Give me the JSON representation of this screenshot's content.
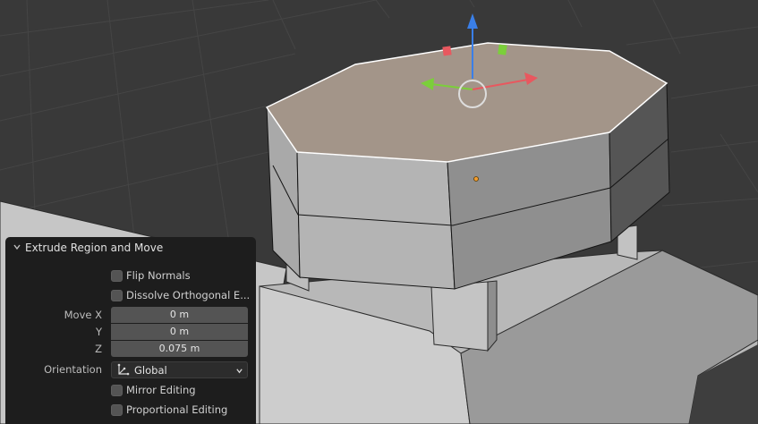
{
  "operator_panel": {
    "title": "Extrude Region and Move",
    "flip_normals": {
      "label": "Flip Normals",
      "checked": false
    },
    "dissolve_orthogonal": {
      "label": "Dissolve Orthogonal E...",
      "checked": false
    },
    "move": {
      "x_label": "Move X",
      "x_value": "0 m",
      "y_label": "Y",
      "y_value": "0 m",
      "z_label": "Z",
      "z_value": "0.075 m"
    },
    "orientation": {
      "label": "Orientation",
      "value": "Global",
      "icon": "global-orientation-icon"
    },
    "mirror_editing": {
      "label": "Mirror Editing",
      "checked": false
    },
    "proportional_editing": {
      "label": "Proportional Editing",
      "checked": false
    }
  },
  "gizmo": {
    "x_axis_color": "#e8585f",
    "y_axis_color": "#7bcf3a",
    "z_axis_color": "#3a7fe8"
  },
  "colors": {
    "viewport_bg": "#393939",
    "grid_line": "#444444",
    "selected_face": "#a39589",
    "panel_bg": "#1d1d1d",
    "field_bg": "#545454"
  }
}
